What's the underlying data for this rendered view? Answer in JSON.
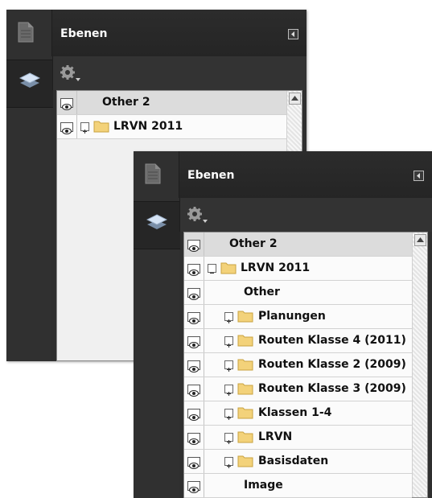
{
  "panel_back": {
    "title": "Ebenen",
    "layers": [
      {
        "name": "Other 2",
        "selected": true
      },
      {
        "name": "LRVN 2011",
        "expand": "+",
        "folder": true
      }
    ]
  },
  "panel_front": {
    "title": "Ebenen",
    "layers": [
      {
        "name": "Other 2",
        "selected": true
      },
      {
        "name": "LRVN 2011",
        "expand": "−",
        "folder": true
      },
      {
        "name": "Other"
      },
      {
        "name": "Planungen",
        "expand": "+",
        "folder": true
      },
      {
        "name": "Routen Klasse 4 (2011)",
        "expand": "+",
        "folder": true
      },
      {
        "name": "Routen Klasse 2 (2009)",
        "expand": "+",
        "folder": true
      },
      {
        "name": "Routen Klasse 3 (2009)",
        "expand": "+",
        "folder": true
      },
      {
        "name": "Klassen 1-4",
        "expand": "+",
        "folder": true
      },
      {
        "name": "LRVN",
        "expand": "+",
        "folder": true
      },
      {
        "name": "Basisdaten",
        "expand": "+",
        "folder": true
      },
      {
        "name": "Image"
      }
    ]
  },
  "icons": {
    "document": "document-icon",
    "layers": "layers-icon",
    "options": "gear-icon",
    "collapse": "collapse-left-icon",
    "visibility": "eye-icon",
    "folder": "folder-icon"
  }
}
